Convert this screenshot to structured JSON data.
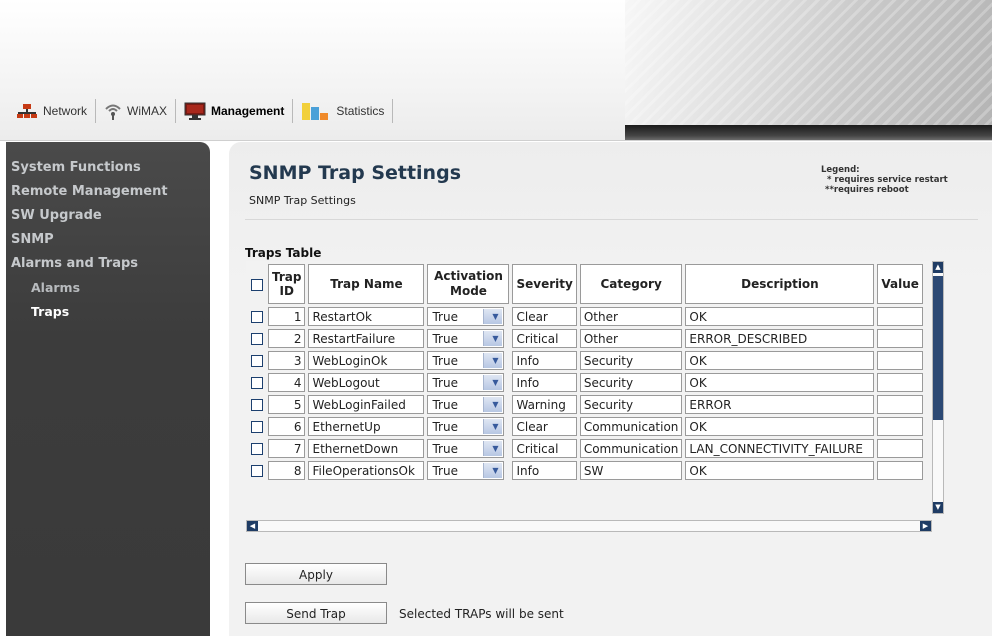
{
  "tabs": [
    {
      "label": "Network",
      "icon": "network-icon",
      "active": false
    },
    {
      "label": "WiMAX",
      "icon": "wireless-icon",
      "active": false
    },
    {
      "label": "Management",
      "icon": "monitor-icon",
      "active": true
    },
    {
      "label": "Statistics",
      "icon": "bar-chart-icon",
      "active": false
    }
  ],
  "sidebar": {
    "items": [
      {
        "label": "System Functions"
      },
      {
        "label": "Remote Management"
      },
      {
        "label": "SW Upgrade"
      },
      {
        "label": "SNMP"
      },
      {
        "label": "Alarms and Traps"
      }
    ],
    "subitems": [
      {
        "label": "Alarms",
        "selected": false
      },
      {
        "label": "Traps",
        "selected": true
      }
    ]
  },
  "main": {
    "title": "SNMP Trap Settings",
    "subtitle": "SNMP Trap Settings",
    "legend": {
      "title": "Legend:",
      "restart_mark": "*",
      "restart_text": "requires service restart",
      "reboot_mark": "**",
      "reboot_text": "requires reboot"
    },
    "table_title": "Traps Table"
  },
  "table": {
    "headers": {
      "trap_id": "Trap ID",
      "trap_name": "Trap Name",
      "activation_mode": "Activation Mode",
      "severity": "Severity",
      "category": "Category",
      "description": "Description",
      "value": "Value"
    },
    "rows": [
      {
        "id": "1",
        "name": "RestartOk",
        "mode": "True",
        "severity": "Clear",
        "category": "Other",
        "description": "OK",
        "value": ""
      },
      {
        "id": "2",
        "name": "RestartFailure",
        "mode": "True",
        "severity": "Critical",
        "category": "Other",
        "description": "ERROR_DESCRIBED",
        "value": ""
      },
      {
        "id": "3",
        "name": "WebLoginOk",
        "mode": "True",
        "severity": "Info",
        "category": "Security",
        "description": "OK",
        "value": ""
      },
      {
        "id": "4",
        "name": "WebLogout",
        "mode": "True",
        "severity": "Info",
        "category": "Security",
        "description": "OK",
        "value": ""
      },
      {
        "id": "5",
        "name": "WebLoginFailed",
        "mode": "True",
        "severity": "Warning",
        "category": "Security",
        "description": "ERROR",
        "value": ""
      },
      {
        "id": "6",
        "name": "EthernetUp",
        "mode": "True",
        "severity": "Clear",
        "category": "Communication",
        "description": "OK",
        "value": ""
      },
      {
        "id": "7",
        "name": "EthernetDown",
        "mode": "True",
        "severity": "Critical",
        "category": "Communication",
        "description": "LAN_CONNECTIVITY_FAILURE",
        "value": ""
      },
      {
        "id": "8",
        "name": "FileOperationsOk",
        "mode": "True",
        "severity": "Info",
        "category": "SW",
        "description": "OK",
        "value": ""
      }
    ]
  },
  "actions": {
    "apply_label": "Apply",
    "send_trap_label": "Send Trap",
    "send_note": "Selected TRAPs will be sent"
  }
}
